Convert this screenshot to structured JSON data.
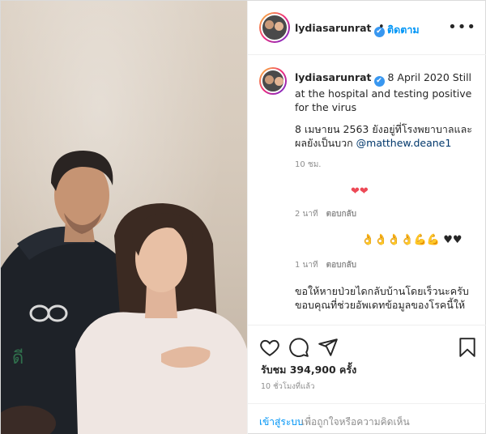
{
  "header": {
    "username": "lydiasarunrat",
    "verified_mark": "✔",
    "separator": "•",
    "follow_label": "ติดตาม",
    "more_label": "•••"
  },
  "caption": {
    "username": "lydiasarunrat",
    "text_en": "8 April 2020 Still at the hospital and testing positive for the virus",
    "text_th": "8 เมษายน 2563 ยังอยู่ที่โรงพยาบาลและผลยังเป็นบวก",
    "mention": "@matthew.deane1",
    "time": "10 ชม."
  },
  "comments": [
    {
      "emojis": "❤❤",
      "time": "2 นาที",
      "reply_label": "ตอบกลับ"
    },
    {
      "emojis_flex": "👌👌👌👌💪💪",
      "emojis_black": "♥♥",
      "time": "1 นาที",
      "reply_label": "ตอบกลับ"
    },
    {
      "text": "ขอให้หายป่วยไดกลับบ้านโดยเร็วนะครับ ขอบคุณที่ช่วยอัพเดทข้อมูลของโรคนี้ให้"
    }
  ],
  "actions": {
    "icons": [
      "heart-icon",
      "comment-icon",
      "share-icon",
      "bookmark-icon"
    ],
    "likes": "รับชม 394,900 ครั้ง",
    "ago": "10 ชั่วโมงที่แล้ว"
  },
  "login": {
    "link": "เข้าสู่ระบบ",
    "rest": "เพื่อถูกใจหรือความคิดเห็น"
  },
  "media": {
    "description_icon": "video-frame-icon"
  }
}
